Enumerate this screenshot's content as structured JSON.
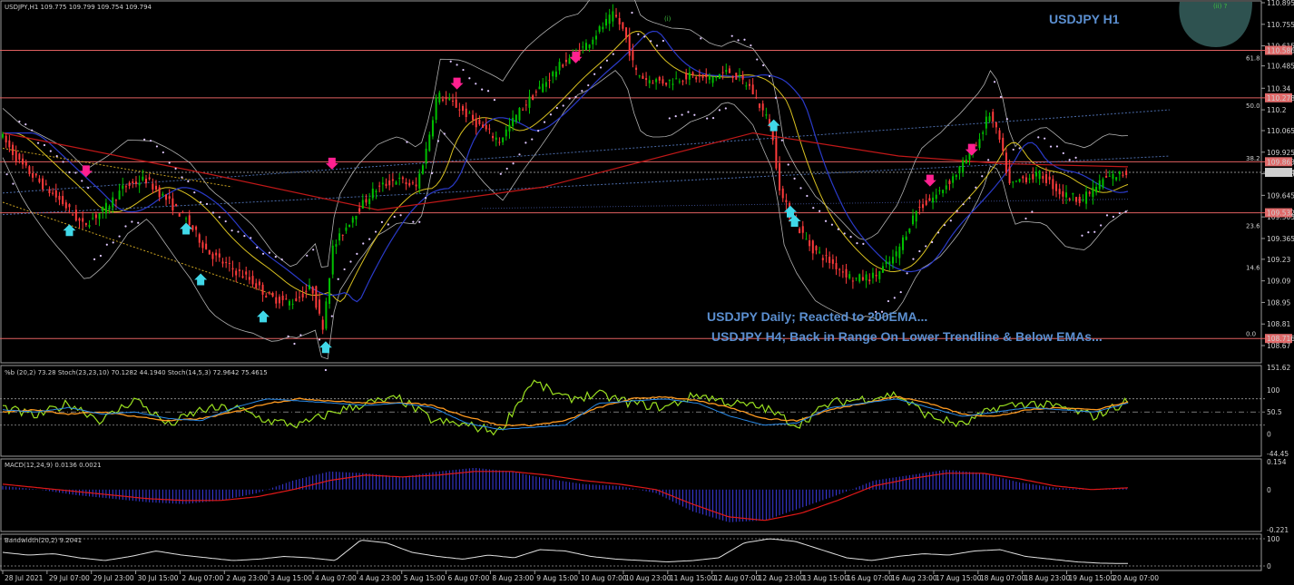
{
  "window": {
    "header": "USDJPY,H1  109.775 109.799 109.754 109.794",
    "symbol_title": "USDJPY H1",
    "wave_label_top": "(i)",
    "wave_label_corner": "(ii) ?"
  },
  "annotations": [
    "USDJPY Daily; Reacted to 200EMA...",
    "USDJPY H4; Back in Range On Lower Trendline & Below EMAs..."
  ],
  "colors": {
    "bull": "#00c000",
    "bear": "#ff3b3b",
    "resistance": "#e06060",
    "ema200": "#c01818",
    "ema_blue": "#2a3ac8",
    "ema_yellow": "#d8c020",
    "bollinger": "#b0b0b0",
    "psar": "#e0c8ff",
    "arrow_down": "#ff2090",
    "arrow_up": "#40d8e8",
    "pb_line": "#9ae020",
    "stoch_orange": "#ff9a20",
    "stoch_blue": "#2a8ae8",
    "macd_hist": "#3a3ae0",
    "macd_signal": "#e01818",
    "bw_line": "#e0e0e0",
    "title_blue": "#5b8fd0"
  },
  "chart_data": [
    {
      "type": "candlestick",
      "title": "USDJPY,H1",
      "ylim": [
        108.57,
        110.895
      ],
      "y_ticks": [
        110.895,
        110.755,
        110.615,
        110.485,
        110.34,
        110.2,
        110.065,
        109.925,
        109.785,
        109.645,
        109.505,
        109.365,
        109.23,
        109.09,
        108.95,
        108.81,
        108.67
      ],
      "price_tags": [
        {
          "label": "110.586",
          "value": 110.586
        },
        {
          "label": "110.278",
          "value": 110.278
        },
        {
          "label": "109.863",
          "value": 109.863
        },
        {
          "label": "109.794",
          "value": 109.794
        },
        {
          "label": "109.532",
          "value": 109.532
        },
        {
          "label": "108.716",
          "value": 108.716
        }
      ],
      "fib_labels": [
        {
          "label": "61.8",
          "value": 110.51
        },
        {
          "label": "50.0",
          "value": 110.2
        },
        {
          "label": "38.2",
          "value": 109.86
        },
        {
          "label": "23.6",
          "value": 109.42
        },
        {
          "label": "14.6",
          "value": 109.15
        },
        {
          "label": "0.0",
          "value": 108.72
        }
      ],
      "horizontal_levels": [
        110.586,
        110.278,
        109.863,
        109.532,
        108.716
      ],
      "x_labels": [
        "28 Jul 2021",
        "29 Jul 07:00",
        "29 Jul 23:00",
        "30 Jul 15:00",
        "2 Aug 07:00",
        "2 Aug 23:00",
        "3 Aug 15:00",
        "4 Aug 07:00",
        "4 Aug 23:00",
        "5 Aug 15:00",
        "6 Aug 07:00",
        "8 Aug 23:00",
        "9 Aug 15:00",
        "10 Aug 07:00",
        "10 Aug 23:00",
        "11 Aug 15:00",
        "12 Aug 07:00",
        "12 Aug 23:00",
        "13 Aug 15:00",
        "16 Aug 07:00",
        "16 Aug 23:00",
        "17 Aug 15:00",
        "18 Aug 07:00",
        "18 Aug 23:00",
        "19 Aug 15:00",
        "20 Aug 07:00"
      ],
      "close_path": [
        [
          0,
          110.05
        ],
        [
          10,
          109.85
        ],
        [
          20,
          109.72
        ],
        [
          30,
          109.6
        ],
        [
          40,
          109.45
        ],
        [
          50,
          109.55
        ],
        [
          60,
          109.7
        ],
        [
          70,
          109.75
        ],
        [
          80,
          109.62
        ],
        [
          90,
          109.48
        ],
        [
          100,
          109.28
        ],
        [
          110,
          109.18
        ],
        [
          120,
          109.1
        ],
        [
          130,
          108.98
        ],
        [
          140,
          108.95
        ],
        [
          150,
          109.05
        ],
        [
          155,
          108.78
        ],
        [
          160,
          109.3
        ],
        [
          170,
          109.52
        ],
        [
          180,
          109.68
        ],
        [
          190,
          109.75
        ],
        [
          200,
          109.7
        ],
        [
          205,
          109.95
        ],
        [
          210,
          110.3
        ],
        [
          220,
          110.22
        ],
        [
          230,
          110.1
        ],
        [
          240,
          110.0
        ],
        [
          250,
          110.2
        ],
        [
          260,
          110.35
        ],
        [
          270,
          110.5
        ],
        [
          280,
          110.6
        ],
        [
          290,
          110.75
        ],
        [
          295,
          110.82
        ],
        [
          300,
          110.7
        ],
        [
          305,
          110.45
        ],
        [
          310,
          110.4
        ],
        [
          320,
          110.38
        ],
        [
          330,
          110.42
        ],
        [
          340,
          110.4
        ],
        [
          350,
          110.45
        ],
        [
          360,
          110.35
        ],
        [
          370,
          110.1
        ],
        [
          375,
          109.65
        ],
        [
          380,
          109.5
        ],
        [
          390,
          109.3
        ],
        [
          400,
          109.2
        ],
        [
          410,
          109.1
        ],
        [
          420,
          109.12
        ],
        [
          430,
          109.25
        ],
        [
          440,
          109.55
        ],
        [
          450,
          109.65
        ],
        [
          460,
          109.8
        ],
        [
          470,
          110.0
        ],
        [
          475,
          110.18
        ],
        [
          480,
          110.0
        ],
        [
          485,
          109.7
        ],
        [
          490,
          109.75
        ],
        [
          500,
          109.78
        ],
        [
          510,
          109.65
        ],
        [
          520,
          109.62
        ],
        [
          530,
          109.75
        ],
        [
          540,
          109.79
        ]
      ],
      "ema200_path": [
        [
          0,
          110.05
        ],
        [
          100,
          109.78
        ],
        [
          180,
          109.55
        ],
        [
          260,
          109.7
        ],
        [
          360,
          110.05
        ],
        [
          430,
          109.9
        ],
        [
          480,
          109.85
        ],
        [
          540,
          109.83
        ]
      ],
      "sell_signals": [
        [
          40,
          109.78
        ],
        [
          158,
          109.83
        ],
        [
          218,
          110.35
        ],
        [
          275,
          110.52
        ],
        [
          445,
          109.72
        ],
        [
          465,
          109.92
        ]
      ],
      "buy_signals": [
        [
          32,
          109.44
        ],
        [
          88,
          109.45
        ],
        [
          95,
          109.12
        ],
        [
          125,
          108.88
        ],
        [
          155,
          108.68
        ],
        [
          370,
          110.12
        ],
        [
          378,
          109.56
        ],
        [
          380,
          109.5
        ]
      ]
    },
    {
      "type": "line",
      "title": "%b (20,2) 73.28  Stoch(23,23,10) 70.1282 44.1940  Stoch(14,5,3) 72.9642 75.4615",
      "ylim": [
        -44.45,
        151.62
      ],
      "y_ticks": [
        151.62,
        100,
        50.5,
        0,
        -44.45
      ],
      "levels": [
        80,
        50,
        20
      ],
      "series": [
        {
          "name": "%b (20,2)",
          "values": [
            60,
            40,
            70,
            30,
            80,
            20,
            55,
            60,
            30,
            20,
            50,
            70,
            80,
            30,
            20,
            5,
            120,
            80,
            90,
            70,
            60,
            90,
            70,
            60,
            20,
            70,
            80,
            90,
            40,
            20,
            60,
            70,
            60,
            40,
            75
          ]
        },
        {
          "name": "Stoch(23,23,10)",
          "values": [
            55,
            50,
            60,
            45,
            50,
            35,
            30,
            60,
            80,
            75,
            70,
            65,
            70,
            60,
            25,
            10,
            15,
            20,
            70,
            75,
            80,
            70,
            40,
            20,
            25,
            60,
            70,
            80,
            60,
            40,
            50,
            60,
            55,
            50,
            70
          ]
        },
        {
          "name": "Stoch(14,5,3)",
          "values": [
            50,
            55,
            45,
            50,
            40,
            30,
            35,
            50,
            70,
            80,
            75,
            70,
            72,
            65,
            40,
            20,
            20,
            30,
            60,
            80,
            85,
            75,
            60,
            35,
            30,
            55,
            70,
            85,
            70,
            45,
            40,
            55,
            60,
            55,
            73
          ]
        }
      ]
    },
    {
      "type": "bar",
      "title": "MACD(12,24,9) 0.0136 0.0021",
      "ylim": [
        -0.221,
        0.154
      ],
      "y_ticks": [
        0.154,
        0.0,
        -0.221
      ],
      "series": [
        {
          "name": "MACD(12,24,9)",
          "values": [
            0.02,
            0.0,
            -0.03,
            -0.05,
            -0.07,
            -0.08,
            -0.06,
            -0.02,
            0.05,
            0.1,
            0.09,
            0.07,
            0.1,
            0.12,
            0.1,
            0.06,
            0.03,
            0.02,
            -0.02,
            -0.12,
            -0.18,
            -0.17,
            -0.1,
            -0.03,
            0.05,
            0.08,
            0.11,
            0.09,
            0.04,
            0.01,
            0.0,
            0.01
          ]
        },
        {
          "name": "signal",
          "values": [
            0.03,
            0.01,
            -0.01,
            -0.03,
            -0.05,
            -0.06,
            -0.06,
            -0.04,
            0.0,
            0.05,
            0.08,
            0.07,
            0.08,
            0.1,
            0.1,
            0.08,
            0.05,
            0.03,
            0.0,
            -0.08,
            -0.15,
            -0.17,
            -0.13,
            -0.06,
            0.02,
            0.06,
            0.09,
            0.09,
            0.06,
            0.02,
            0.0,
            0.01
          ]
        }
      ]
    },
    {
      "type": "line",
      "title": "Bandwidth(20,2) 9.2041",
      "ylim": [
        -10,
        110
      ],
      "y_ticks": [
        100,
        0
      ],
      "series": [
        {
          "name": "Bandwidth(20,2)",
          "values": [
            50,
            40,
            45,
            30,
            20,
            35,
            55,
            40,
            30,
            20,
            25,
            35,
            30,
            20,
            95,
            85,
            50,
            35,
            25,
            40,
            30,
            60,
            55,
            35,
            25,
            20,
            15,
            20,
            30,
            85,
            100,
            90,
            60,
            30,
            20,
            35,
            45,
            40,
            55,
            60,
            35,
            25,
            15,
            10,
            9
          ]
        }
      ]
    }
  ]
}
